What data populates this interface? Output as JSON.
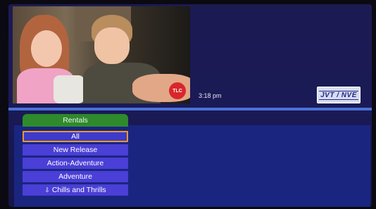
{
  "header": {
    "time": "3:18 pm",
    "channel_logo": "TLC",
    "brand_logo": "JVT / NVE"
  },
  "menu": {
    "tab_label": "Rentals",
    "items": [
      {
        "label": "All",
        "selected": true
      },
      {
        "label": "New Release",
        "selected": false
      },
      {
        "label": "Action-Adventure",
        "selected": false
      },
      {
        "label": "Adventure",
        "selected": false
      },
      {
        "label": "Chills and Thrills",
        "selected": false,
        "icon": "scroll-down-arrow-icon"
      }
    ]
  },
  "colors": {
    "background": "#1c1a52",
    "tab": "#2e8a2c",
    "menu_item": "#4a3fd6",
    "selection_border": "#e89a26"
  }
}
